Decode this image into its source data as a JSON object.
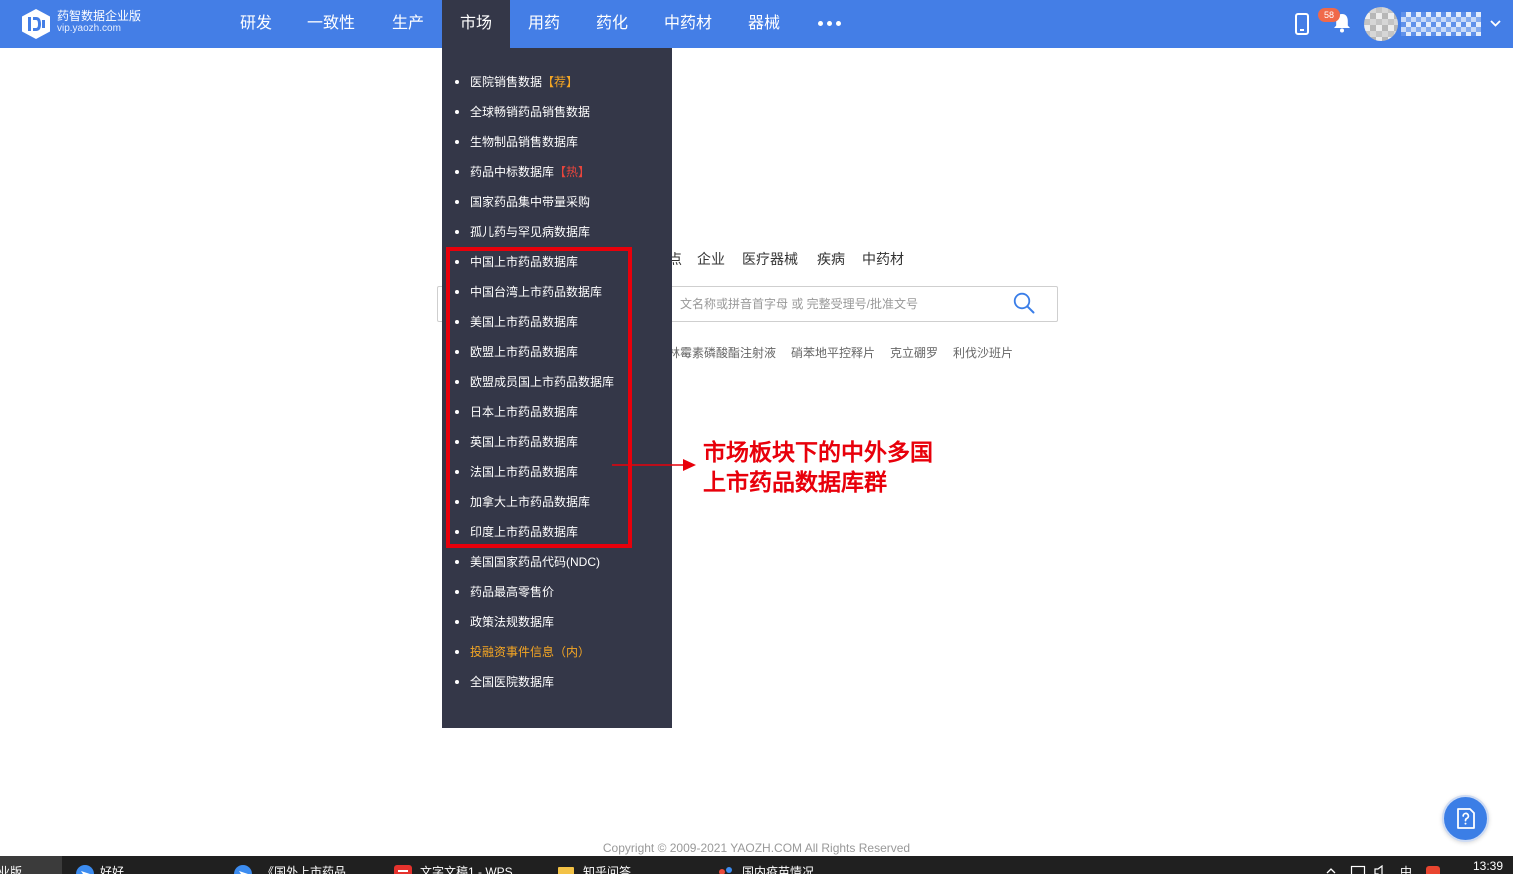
{
  "app": {
    "logo_title": "药智数据企业版",
    "logo_domain": "vip.yaozh.com"
  },
  "nav": {
    "items": [
      {
        "label": "研发"
      },
      {
        "label": "一致性"
      },
      {
        "label": "生产"
      },
      {
        "label": "市场",
        "active": true
      },
      {
        "label": "用药"
      },
      {
        "label": "药化"
      },
      {
        "label": "中药材"
      },
      {
        "label": "器械"
      }
    ]
  },
  "header": {
    "notification_count": "58"
  },
  "market_menu": {
    "items": [
      {
        "label": "医院销售数据",
        "tag": "【荐】"
      },
      {
        "label": "全球畅销药品销售数据"
      },
      {
        "label": "生物制品销售数据库"
      },
      {
        "label": "药品中标数据库",
        "tag": "【热】"
      },
      {
        "label": "国家药品集中带量采购"
      },
      {
        "label": "孤儿药与罕见病数据库"
      },
      {
        "label": "中国上市药品数据库"
      },
      {
        "label": "中国台湾上市药品数据库"
      },
      {
        "label": "美国上市药品数据库"
      },
      {
        "label": "欧盟上市药品数据库"
      },
      {
        "label": "欧盟成员国上市药品数据库"
      },
      {
        "label": "日本上市药品数据库"
      },
      {
        "label": "英国上市药品数据库"
      },
      {
        "label": "法国上市药品数据库"
      },
      {
        "label": "加拿大上市药品数据库"
      },
      {
        "label": "印度上市药品数据库"
      },
      {
        "label": "美国国家药品代码(NDC)"
      },
      {
        "label": "药品最高零售价"
      },
      {
        "label": "政策法规数据库"
      },
      {
        "label": "投融资事件信息（内）",
        "highlighted": true
      },
      {
        "label": "全国医院数据库"
      }
    ]
  },
  "annotation": {
    "lines": [
      "市场板块下的中外多国",
      "上市药品数据库群"
    ]
  },
  "search": {
    "tabs": [
      "点",
      "企业",
      "医疗器械",
      "疾病",
      "中药材"
    ],
    "placeholder": "）文名称或拼音首字母 或 完整受理号/批准文号",
    "suggestions": [
      "林霉素磷酸酯注射液",
      "硝苯地平控释片",
      "克立硼罗",
      "利伐沙班片"
    ]
  },
  "footer": {
    "copyright": "Copyright © 2009-2021 YAOZH.COM All Rights Reserved"
  },
  "taskbar": {
    "items": [
      {
        "label": "业版"
      },
      {
        "label": "好好"
      },
      {
        "label": "《国外上市药品"
      },
      {
        "label": "文字文稿1 - WPS"
      },
      {
        "label": "知乎问答"
      },
      {
        "label": "国内疫苗情况"
      }
    ],
    "ime": "中",
    "time": "13:39"
  },
  "colors": {
    "header_blue": "#447ee6",
    "menu_bg": "#343748",
    "annotation_red": "#e8000b",
    "recommend_tag": "#f5a623",
    "hot_tag": "#e8453c",
    "highlight_item": "#f5a623",
    "badge": "#f0694a",
    "help_button": "#3b7ee6"
  },
  "icons": {
    "logo": "yaozh-logo-icon",
    "phone": "mobile-phone-icon",
    "bell": "bell-icon",
    "more": "more-dots-icon",
    "caret": "chevron-down-icon",
    "search": "search-icon",
    "help": "help-feedback-icon",
    "arrow": "arrow-right-icon"
  }
}
